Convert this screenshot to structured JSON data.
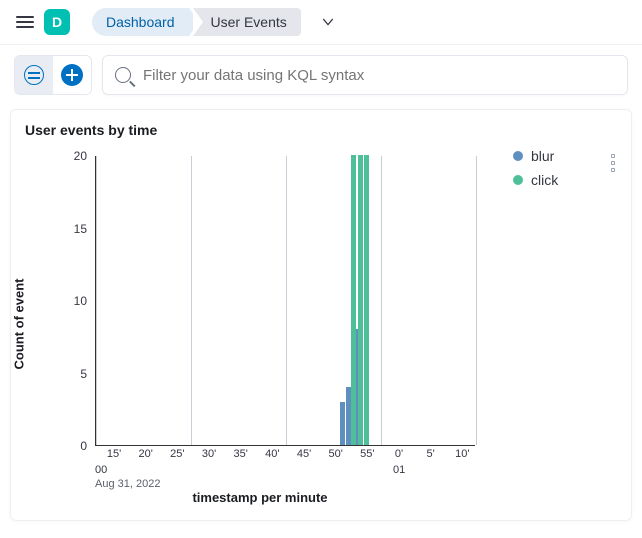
{
  "header": {
    "app_letter": "D",
    "breadcrumb": [
      "Dashboard",
      "User Events"
    ]
  },
  "search": {
    "placeholder": "Filter your data using KQL syntax"
  },
  "panel": {
    "title": "User events by time"
  },
  "chart_data": {
    "type": "bar",
    "title": "User events by time",
    "xlabel": "timestamp per minute",
    "ylabel": "Count of event",
    "ylim": [
      0,
      20
    ],
    "y_ticks": [
      0,
      5,
      10,
      15,
      20
    ],
    "x_tick_labels": [
      "15'",
      "20'",
      "25'",
      "30'",
      "35'",
      "40'",
      "45'",
      "50'",
      "55'",
      "0'",
      "5'",
      "10'"
    ],
    "x_hour_labels": {
      "start": "00",
      "next": "01"
    },
    "x_date_label": "Aug 31, 2022",
    "x_minutes": [
      15,
      20,
      25,
      30,
      35,
      40,
      45,
      50,
      55,
      60,
      65,
      70
    ],
    "gridlines_at_minutes": [
      12,
      27,
      42,
      57,
      72
    ],
    "series": [
      {
        "name": "blur",
        "color": "#5e8fbf",
        "points": [
          {
            "minute": 51,
            "value": 3
          },
          {
            "minute": 52,
            "value": 4
          },
          {
            "minute": 53,
            "value": 8
          }
        ]
      },
      {
        "name": "click",
        "color": "#4fbf9a",
        "points": [
          {
            "minute": 52,
            "value": 20
          },
          {
            "minute": 53,
            "value": 20
          },
          {
            "minute": 54,
            "value": 20
          }
        ]
      }
    ],
    "legend": [
      "blur",
      "click"
    ]
  }
}
